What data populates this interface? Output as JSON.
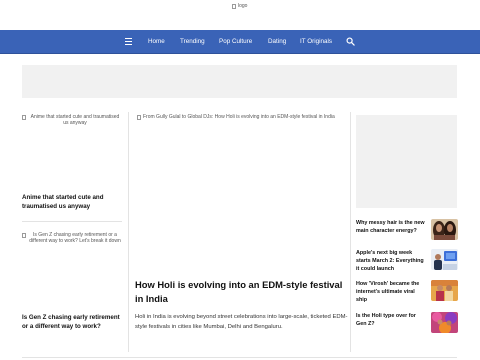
{
  "header": {
    "logo_alt": "logo"
  },
  "nav": {
    "menu_icon": "hamburger-menu-icon",
    "items": [
      {
        "label": "Home"
      },
      {
        "label": "Trending"
      },
      {
        "label": "Pop Culture"
      },
      {
        "label": "Dating"
      },
      {
        "label": "IT Originals"
      }
    ],
    "search_icon": "search-icon",
    "background_color": "#3a63b7"
  },
  "left_column": {
    "articles": [
      {
        "image_alt": "Anime that started cute and traumatised us anyway",
        "title": "Anime that started cute and traumatised us anyway"
      },
      {
        "image_alt": "Is Gen Z chasing early retirement or a different way to work? Let's break it down",
        "title": "Is Gen Z chasing early retirement or a different way to work?"
      }
    ]
  },
  "hero": {
    "image_alt": "From Gully Gulal to Global DJs: How Holi is evolving into an EDM-style festival in India",
    "title": "How Holi is evolving into an EDM-style festival in India",
    "description": "Holi in India is evolving beyond street celebrations into large-scale, ticketed EDM-style festivals in cities like Mumbai, Delhi and Bengaluru."
  },
  "sidebar": {
    "items": [
      {
        "title": "Why messy hair is the new main character energy?",
        "thumb_icon": "women-hair-photo"
      },
      {
        "title": "Apple's next big week starts March 2: Everything it could launch",
        "thumb_icon": "apple-event-photo"
      },
      {
        "title": "How 'Virosh' became the internet's ultimate viral ship",
        "thumb_icon": "couple-wedding-photo"
      },
      {
        "title": "Is the Holi type over for Gen Z?",
        "thumb_icon": "holi-celebration-photo"
      }
    ]
  }
}
